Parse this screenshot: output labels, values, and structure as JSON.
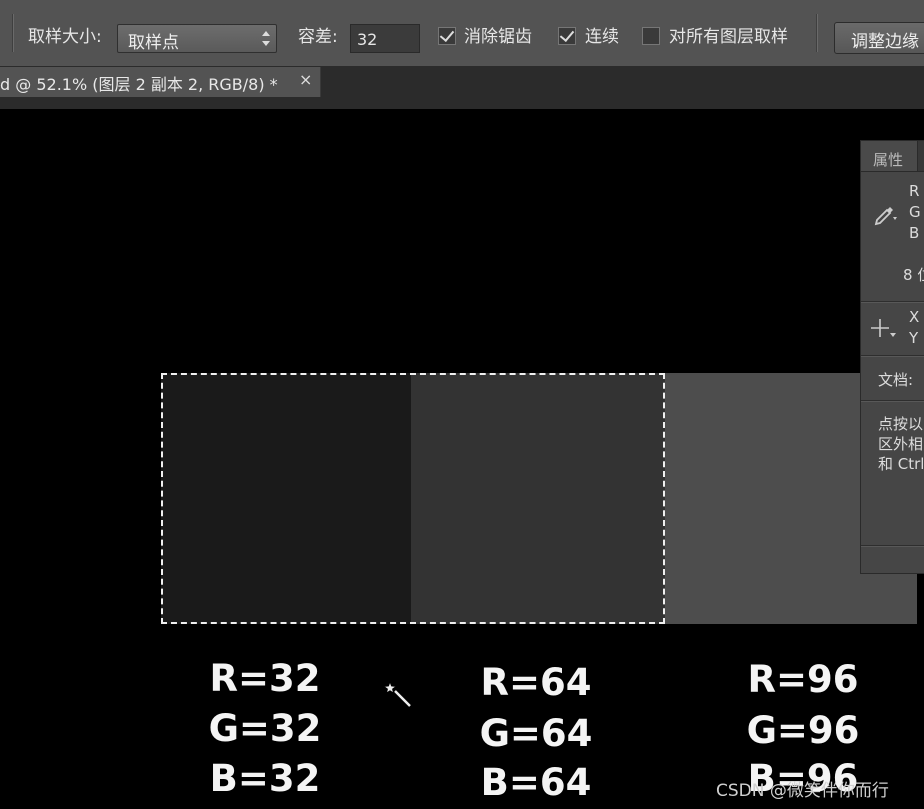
{
  "options_bar": {
    "sample_size_label": "取样大小:",
    "sample_size_value": "取样点",
    "tolerance_label": "容差:",
    "tolerance_value": "32",
    "antialias_label": "消除锯齿",
    "contiguous_label": "连续",
    "all_layers_label": "对所有图层取样",
    "refine_edge_label": "调整边缘"
  },
  "document_tab": {
    "title": "d @ 52.1% (图层 2 副本 2, RGB/8) *",
    "close": "×"
  },
  "swatches": [
    {
      "color": "#1a1a1a",
      "r": "R=32",
      "g": "G=32",
      "b": "B=32"
    },
    {
      "color": "#333333",
      "r": "R=64",
      "g": "G=64",
      "b": "B=64"
    },
    {
      "color": "#4d4d4d",
      "r": "R=96",
      "g": "G=96",
      "b": "B=96"
    }
  ],
  "properties_panel": {
    "tab": "属性",
    "r": "R",
    "g": "G",
    "b": "B",
    "bits": "8 位",
    "x": "X",
    "y": "Y",
    "doc": "文档:",
    "hint_line1": "点按以",
    "hint_line2": "区外相",
    "hint_line3": "和 Ctrl"
  },
  "watermark": "CSDN @微笑伴你而行",
  "colors": {
    "toolbar": "#535353",
    "canvas": "#000000",
    "panel": "#464646"
  }
}
